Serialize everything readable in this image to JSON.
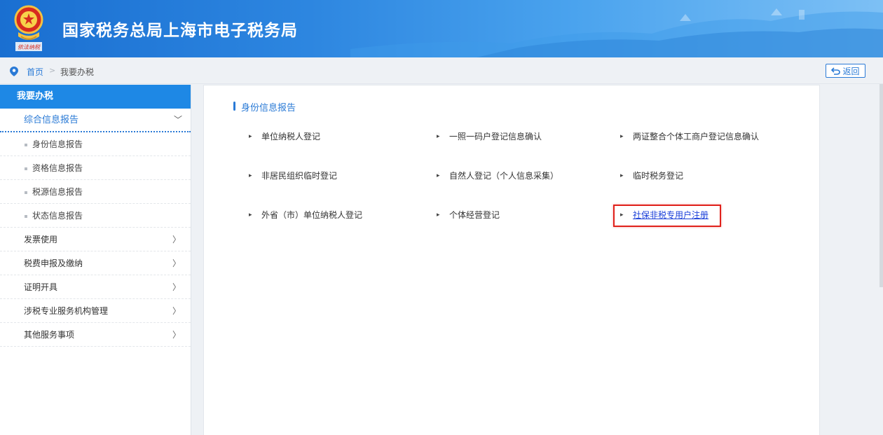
{
  "header": {
    "title": "国家税务总局上海市电子税务局",
    "emblem_caption": "依法纳税"
  },
  "breadcrumb": {
    "home": "首页",
    "separator": ">",
    "current": "我要办税"
  },
  "back_button": {
    "label": "返回"
  },
  "sidebar": {
    "heading": "我要办税",
    "active_group": {
      "label": "综合信息报告",
      "chevron": "﹀"
    },
    "sub_items": [
      "身份信息报告",
      "资格信息报告",
      "税源信息报告",
      "状态信息报告"
    ],
    "items": [
      {
        "label": "发票使用",
        "arrow": "〉"
      },
      {
        "label": "税费申报及缴纳",
        "arrow": "〉"
      },
      {
        "label": "证明开具",
        "arrow": "〉"
      },
      {
        "label": "涉税专业服务机构管理",
        "arrow": "〉"
      },
      {
        "label": "其他服务事项",
        "arrow": "〉"
      }
    ]
  },
  "main": {
    "section_title": "身份信息报告",
    "links": [
      [
        "单位纳税人登记",
        "一照一码户登记信息确认",
        "两证整合个体工商户登记信息确认"
      ],
      [
        "非居民组织临时登记",
        "自然人登记（个人信息采集）",
        "临时税务登记"
      ],
      [
        "外省（市）单位纳税人登记",
        "个体经营登记",
        "社保非税专用户注册"
      ]
    ],
    "highlighted_link": "社保非税专用户注册"
  },
  "colors": {
    "accent": "#2a7ad6",
    "header_start": "#1a6fd1",
    "highlight_border": "#e0211b",
    "highlighted_link": "#1a3fd9"
  }
}
